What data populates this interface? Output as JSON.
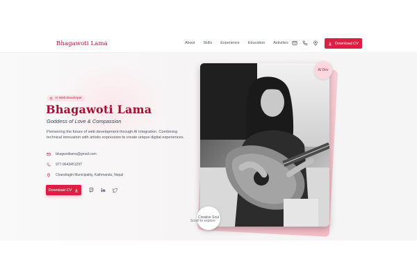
{
  "navbar": {
    "brand": "Bhagawoti Lama",
    "links": [
      "About",
      "Skills",
      "Experience",
      "Education",
      "Activities"
    ],
    "icons": [
      "mail-icon",
      "phone-icon",
      "location-icon"
    ],
    "cv_button": "Download CV"
  },
  "hero": {
    "role_badge": "AI Web Developer",
    "name": "Bhagawoti Lama",
    "subtitle": "Goddess of Love & Compassion",
    "description": "Pioneering the future of web development through AI integration. Combining technical innovation with artistic expression to create unique digital experiences.",
    "email": "bhagwotilama@gmail.com",
    "phone": "977-9643451297",
    "location": "Chandragiri Municipality, Kathmandu, Nepal",
    "cv_button": "Download CV",
    "socials": [
      "twitch-icon",
      "linkedin-icon",
      "twitter-icon"
    ]
  },
  "photo_card": {
    "top_badge": "AI Dev",
    "bottom_badge": "Creative Soul",
    "scroll_hint": "Scroll to explore"
  },
  "colors": {
    "accent": "#dc2045",
    "brand": "#a80f31",
    "badge_bg": "#fde3e8"
  }
}
